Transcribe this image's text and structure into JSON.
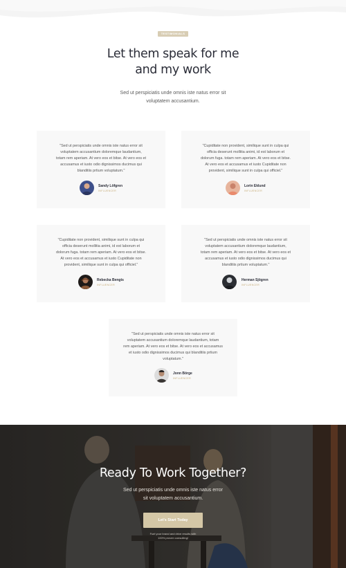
{
  "colors": {
    "badge": "#d8cdb4",
    "accent": "#c7ad7a",
    "card_bg": "#f8f8f8",
    "heading": "#2b2d38",
    "cta_button": "#d4c7a6"
  },
  "testimonials_section": {
    "badge": "TESTIMONIALS",
    "title_lines": [
      "Let them speak for me",
      "and my work"
    ],
    "subtitle_lines": [
      "Sed ut perspiciatis unde omnis iste natus error sit",
      "voluptatem accusantium."
    ]
  },
  "testimonials": [
    {
      "quote_lines": [
        "\"Sed ut perspiciatis unde omnis iste natus error sit",
        "voluptatem accusantium doloremque laudantium,",
        "totam rem aperiam. At vero eos et bitse. At vero eos et",
        "accusamus et iusto odio dignissimos ducimus qui",
        "blanditiis prtium voluptatum.\""
      ],
      "name": "Sandy Löfgren",
      "role": "INFLUENCER",
      "avatar_icon": "person-avatar-icon"
    },
    {
      "quote_lines": [
        "\"Cupiditate non provident, similique sunt in culpa qui",
        "officia deserunt mollitia animi, id est laborum et",
        "dolorum fuga. totam rem aperiam. At vero eos et bitse.",
        "At vero eos et accusamus et iusto Cupiditate non",
        "provident, similique sunt in culpa qui officiel.\""
      ],
      "name": "Lorin Eklund",
      "role": "INFLUENCER",
      "avatar_icon": "person-avatar-icon"
    },
    {
      "quote_lines": [
        "\"Cupiditate non provident, similique sunt in culpa qui",
        "officia deserunt mollitia animi, id est laborum et",
        "dolorum fuga. totam rem aperiam. At vero eos et bitse.",
        "At vero eos et accusamus et iusto Cupiditate non",
        "provident, similique sunt in culpa qui officiel.\""
      ],
      "name": "Rebecka Bengts",
      "role": "INFLUENCER",
      "avatar_icon": "person-avatar-icon"
    },
    {
      "quote_lines": [
        "\"Sed ut perspiciatis unde omnis iste natus error sit",
        "voluptatem accusantium doloremque laudantium,",
        "totam rem aperiam. At vero eos et bitse. At vero eos et",
        "accusamus et iusto odio dignissimos ducimus qui",
        "blanditiis prtium voluptatum.\""
      ],
      "name": "Herman Sjögren",
      "role": "INFLUENCER",
      "avatar_icon": "person-avatar-icon"
    },
    {
      "quote_lines": [
        "\"Sed ut perspiciatis unde omnis iste natus error sit",
        "voluptatem accusantium doloremque laudantium, totam",
        "rem aperiam. At vero eos et bitse. At vero eos et accusamus",
        "et iusto odio dignissimos ducimus qui blanditiis prtium",
        "voluptatum.\""
      ],
      "name": "Jonn Börge",
      "role": "INFLUENCER",
      "avatar_icon": "person-avatar-icon"
    }
  ],
  "cta": {
    "title": "Ready To Work Together?",
    "subtitle_lines": [
      "Sed ut perspiciatis unde omnis iste natus error",
      "sit voluptatem accusantium."
    ],
    "button": "Let's Start Today",
    "note_lines": [
      "Fuel your brand and drive results with",
      "100% proven consulting!"
    ]
  }
}
